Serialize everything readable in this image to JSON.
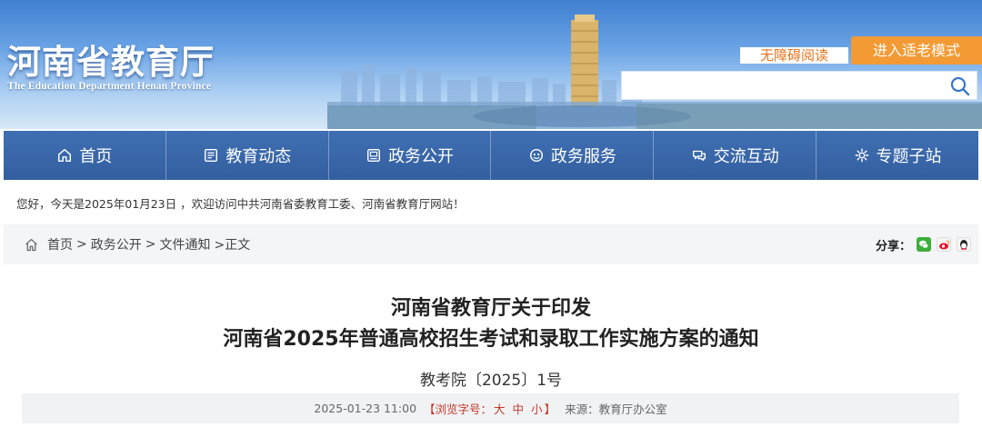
{
  "header": {
    "site_title": "河南省教育厅",
    "site_subtitle": "The Education Department Henan Province",
    "accessible_label": "无障碍阅读",
    "elder_mode_label": "进入适老模式",
    "search_placeholder": ""
  },
  "nav": {
    "items": [
      {
        "label": "首页",
        "icon": "home-icon"
      },
      {
        "label": "教育动态",
        "icon": "news-icon"
      },
      {
        "label": "政务公开",
        "icon": "document-icon"
      },
      {
        "label": "政务服务",
        "icon": "service-icon"
      },
      {
        "label": "交流互动",
        "icon": "chat-icon"
      },
      {
        "label": "专题子站",
        "icon": "gear-icon"
      }
    ]
  },
  "welcome_text": "您好，今天是2025年01月23日 ，欢迎访问中共河南省委教育工委、河南省教育厅网站！",
  "breadcrumb": {
    "home": "首页",
    "sep": ">",
    "items": [
      "政务公开",
      "文件通知"
    ],
    "current": ">正文"
  },
  "share": {
    "label": "分享：",
    "icons": [
      "wechat-icon",
      "weibo-icon",
      "qq-icon"
    ]
  },
  "article": {
    "title_line1": "河南省教育厅关于印发",
    "title_line2": "河南省2025年普通高校招生考试和录取工作实施方案的通知",
    "doc_number": "教考院〔2025〕1号",
    "date": "2025-01-23 11:00",
    "font_size_prefix": "【浏览字号：",
    "font_sizes": [
      "大",
      "中",
      "小"
    ],
    "font_size_suffix": "】",
    "source": "来源：教育厅办公室"
  },
  "colors": {
    "nav_bg": "#3a68aa",
    "elder_button": "#f39a34",
    "accessible_text": "#e7741c",
    "font_ctrl": "#c0392b"
  }
}
